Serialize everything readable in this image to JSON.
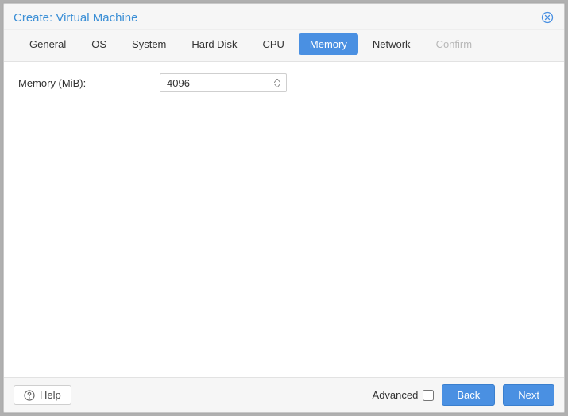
{
  "title": "Create: Virtual Machine",
  "tabs": [
    {
      "label": "General",
      "state": "normal"
    },
    {
      "label": "OS",
      "state": "normal"
    },
    {
      "label": "System",
      "state": "normal"
    },
    {
      "label": "Hard Disk",
      "state": "normal"
    },
    {
      "label": "CPU",
      "state": "normal"
    },
    {
      "label": "Memory",
      "state": "active"
    },
    {
      "label": "Network",
      "state": "normal"
    },
    {
      "label": "Confirm",
      "state": "disabled"
    }
  ],
  "form": {
    "memory_label": "Memory (MiB):",
    "memory_value": "4096"
  },
  "footer": {
    "help_label": "Help",
    "advanced_label": "Advanced",
    "advanced_checked": false,
    "back_label": "Back",
    "next_label": "Next"
  }
}
